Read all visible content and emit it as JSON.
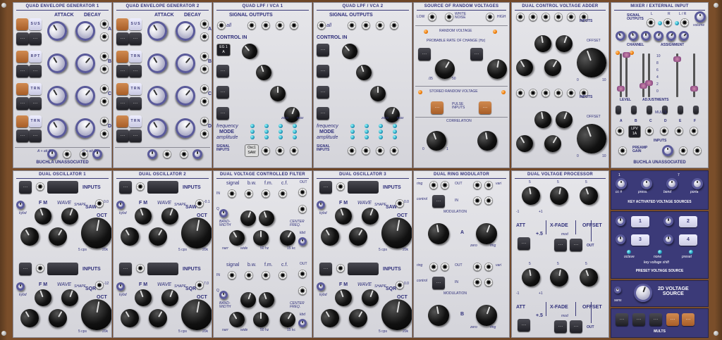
{
  "modules": {
    "env1": {
      "title": "QUAD ENVELOPE GENERATOR 1",
      "attack": "ATTACK",
      "decay": "DECAY",
      "buttons": [
        "S U S",
        "...",
        "R P T",
        "...",
        "T R N",
        "...",
        "T R N",
        "..."
      ],
      "outs": [
        "A",
        "B",
        "C",
        "D"
      ],
      "sub": "att.",
      "sub2": "decay",
      "scale": [
        ".001",
        "10",
        ".001",
        "10"
      ],
      "footer": "BUCHLA UNASSOCIATED",
      "ab": "A + att.B",
      "cd": "C + att.D"
    },
    "env2": {
      "title": "QUAD ENVELOPE GENERATOR 2",
      "attack": "ATTACK",
      "decay": "DECAY",
      "buttons": [
        "S U S",
        "...",
        "T R N",
        "...",
        "T R N",
        "...",
        "T R N",
        "..."
      ],
      "outs": [
        "A",
        "B",
        "C",
        "D"
      ]
    },
    "lpf1": {
      "title": "QUAD LPF / VCA 1",
      "signal_outputs": "SIGNAL OUTPUTS",
      "all": "all",
      "control_in": "CONTROL IN",
      "eg_tag": "EG 1\nA",
      "frequency": "frequency",
      "mode": "MODE",
      "amplitude": "amplitude",
      "signal_inputs": "SIGNAL\nINPUTS",
      "osc_tag": "Osc1\nSAW",
      "zero": "zero",
      "max": "max"
    },
    "lpf2": {
      "title": "QUAD LPF / VCA 2",
      "signal_outputs": "SIGNAL OUTPUTS",
      "all": "all",
      "control_in": "CONTROL IN",
      "frequency": "frequency",
      "mode": "MODE",
      "amplitude": "amplitude",
      "signal_inputs": "SIGNAL\nINPUTS",
      "zero": "zero",
      "max": "max"
    },
    "rand": {
      "title": "SOURCE OF RANDOM VOLTAGES",
      "low": "LOW",
      "white_noise": "WHITE\nNOISE",
      "high": "HIGH",
      "random_voltage": "RANDOM VOLTAGE",
      "prob": "PROBABLE RATE OF CHANGE (Hz)",
      "r1": ".05",
      "r2": "50",
      "stored": "STORED RANDOM VOLTAGE",
      "pulse": "PULSE\nINPUTS",
      "correlation": "CORRELATION",
      "c0": "0",
      "c1": "1"
    },
    "adder": {
      "title": "DUAL CONTROL VOLTAGE ADDER",
      "inputs": "INPUTS",
      "offset": "OFFSET",
      "zero": "0",
      "ten": "10"
    },
    "mixer": {
      "title": "MIXER / EXTERNAL INPUT",
      "signal_outputs": "SIGNAL\nOUTPUTS",
      "l": "L",
      "r": "R",
      "lr": "L / R",
      "volume": "volume",
      "channel": "CHANNEL",
      "assignment": "ASSIGNMENT",
      "scale": [
        "10",
        "8",
        "6",
        "4",
        "2",
        "0"
      ],
      "level": "LEVEL",
      "adjustments": "ADJUSTMENTS",
      "mults": "MULTS",
      "inputs_letters": [
        "A",
        "B",
        "C",
        "D",
        "E",
        "F"
      ],
      "lpv_tag": "LPV\n1A",
      "inputs": "INPUTS",
      "preamp": "PREAMP\nGAIN",
      "footer": "BUCHLA UNASSOCIATED"
    },
    "osc1": {
      "title": "DUAL OSCILLATOR 1",
      "inputs": "INPUTS",
      "kybd": "kybd",
      "fm": "F M",
      "wave": "WAVE",
      "shape": "SHAPE",
      "saw": "SAW",
      "sqr": "SQR",
      "oct": "OCT",
      "val1": "0.0",
      "val2": "-12",
      "cps": "5 cps",
      "k20": "20k"
    },
    "osc2": {
      "title": "DUAL OSCILLATOR 2",
      "inputs": "INPUTS",
      "kybd": "kybd",
      "fm": "F M",
      "wave": "WAVE",
      "shape": "SHAPE",
      "saw": "SAW",
      "sqr": "SQR",
      "oct": "OCT",
      "val1": "-0.1",
      "val2": "7.0",
      "cps": "5 cps",
      "k20": "20k"
    },
    "vcf": {
      "title": "DUAL VOLTAGE CONTROLLED FILTER",
      "signal": "signal",
      "bw": "b.w.",
      "fm": "f.m.",
      "cf": "c.f.",
      "in": "IN",
      "out": "OUT",
      "q": "Q",
      "bandwidth": "BAND-\nWIDTH",
      "center": "CENTER\nFREQ.",
      "narr": "narr",
      "wide": "wide",
      "hz50": "50 hz",
      "k15": "15 kc",
      "kbd": "kbd"
    },
    "osc3": {
      "title": "DUAL OSCILLATOR 3",
      "inputs": "INPUTS",
      "kybd": "kybd",
      "fm": "F M",
      "wave": "WAVE",
      "shape": "SHAPE",
      "saw": "SAW",
      "sqr": "SQR",
      "oct": "OCT",
      "val1": "0.0",
      "val2": "0.0",
      "cps": "5 cps",
      "k20": "20k"
    },
    "ring": {
      "title": "DUAL RING MODULATOR",
      "ring": "ring",
      "out": "OUT",
      "vari": "vari",
      "control": "control",
      "in": "IN",
      "modulation": "MODULATION",
      "a": "A",
      "b": "B",
      "zero": "zero",
      "ring_lbl": "ring"
    },
    "proc": {
      "title": "DUAL VOLTAGE PROCESSOR",
      "s1": "5",
      "s2": "5",
      "s3": "5",
      "att": "ATT",
      "xfade": "X-FADE",
      "offset": "OFFSET",
      "mod": "mod",
      "plus5": "+.5",
      "out": "OUT",
      "m1": "-1",
      "p1": "+1",
      "p5": "+5"
    },
    "kav": {
      "title": "KEY ACTIVATED VOLTAGE SOURCES",
      "cc": "cc #",
      "press": "press.",
      "bend": "bend",
      "porta": "porta",
      "one": "1",
      "seven": "7"
    },
    "pvs": {
      "title": "PRESET VOLTAGE SOURCE",
      "octave": "octave",
      "none": "none",
      "preset": "preset",
      "key_voltage_shift": "key voltage shift",
      "n": [
        "1",
        "2",
        "3",
        "4"
      ]
    },
    "v2d": {
      "title": "2D VOLTAGE\nSOURCE",
      "sens": "sens"
    },
    "mults": {
      "title": "MULTS"
    }
  },
  "colors": {
    "panel": "#dcdce2",
    "ink": "#2f2f7a",
    "blue_panel": "#3b3a78",
    "orange": "#c07840",
    "wood": "#6b4426"
  },
  "icons": [
    "knob",
    "jack",
    "led",
    "fader",
    "button"
  ]
}
